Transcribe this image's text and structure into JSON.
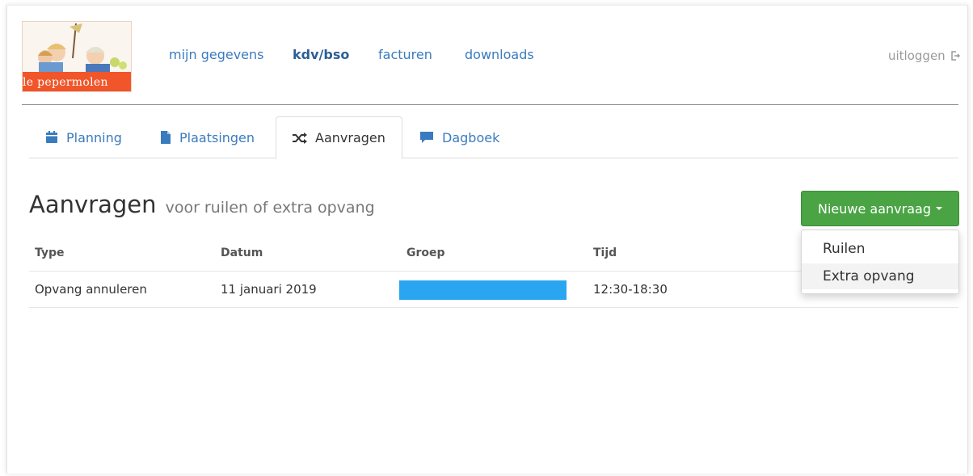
{
  "logo": {
    "text": "le pepermolen"
  },
  "nav": {
    "items": [
      {
        "label": "mijn gegevens",
        "active": false
      },
      {
        "label": "kdv/bso",
        "active": true
      },
      {
        "label": "facturen",
        "active": false
      },
      {
        "label": "downloads",
        "active": false
      }
    ],
    "logout": "uitloggen"
  },
  "tabs": [
    {
      "label": "Planning",
      "icon": "calendar-icon",
      "active": false
    },
    {
      "label": "Plaatsingen",
      "icon": "file-icon",
      "active": false
    },
    {
      "label": "Aanvragen",
      "icon": "shuffle-icon",
      "active": true
    },
    {
      "label": "Dagboek",
      "icon": "comment-icon",
      "active": false
    }
  ],
  "header": {
    "title": "Aanvragen",
    "subtitle": "voor ruilen of extra opvang",
    "new_button": "Nieuwe aanvraag",
    "dropdown": [
      {
        "label": "Ruilen",
        "hover": false
      },
      {
        "label": "Extra opvang",
        "hover": true
      }
    ]
  },
  "table": {
    "columns": [
      "Type",
      "Datum",
      "Groep",
      "Tijd"
    ],
    "rows": [
      {
        "type": "Opvang annuleren",
        "datum": "11 januari 2019",
        "groep_color": "#2aa5f2",
        "tijd": "12:30-18:30"
      }
    ]
  },
  "colors": {
    "link": "#3a7bbf",
    "button_green": "#4aa444",
    "logo_orange": "#f1552a",
    "group_blue": "#2aa5f2"
  }
}
